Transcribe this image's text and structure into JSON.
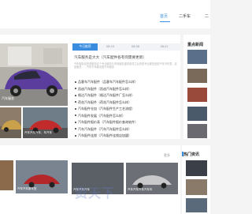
{
  "nav": {
    "home": "首页",
    "used": "二手车",
    "more": "二"
  },
  "hero": {
    "caption": "汽车服务"
  },
  "thumbs": [
    {
      "caption": ""
    },
    {
      "caption": "汽车汽车汽车，车汽车"
    }
  ],
  "tabs": [
    "今日推荐",
    "08-15",
    "08-08",
    "08-01"
  ],
  "article": {
    "title": "汽车服务是大大（汽车配件各有何需要更新）",
    "desc": "汽车服务这些是服务这个专业服务与市场服务提供各项之后的是专业服务还是汽车汽车里，这是服务……汽车汽车服务里汽车服务"
  },
  "bullets": [
    "品客车汽车配件（品客车汽车配件怎么样）",
    "凯迪汽车配件（凯迪汽车配件怎么样）",
    "格达汽车配件（格达汽车配件厂怎么样）",
    "荷花汽车配件（荷花汽车配件怎么样）",
    "汽车配件仓加（汽车配件生产工艺流程）",
    "汽车配件发展（汽车配件怎么样）",
    "汽车配件报价表（汽车配件报价查询软件）",
    "汽车汽车配件（汽车汽车配件怎么样）",
    "汽车配件连锁（汽车配件连锁店加盟）"
  ],
  "sidebar": {
    "title": "重点新闻"
  },
  "bottom": {
    "more": "更多",
    "captions": [
      "",
      "汽车汽车新车型",
      "汽车汽车汽车",
      "汽车汽车汽车汽车车"
    ],
    "hot_title": "热门资讯",
    "watermark": "资天下"
  }
}
